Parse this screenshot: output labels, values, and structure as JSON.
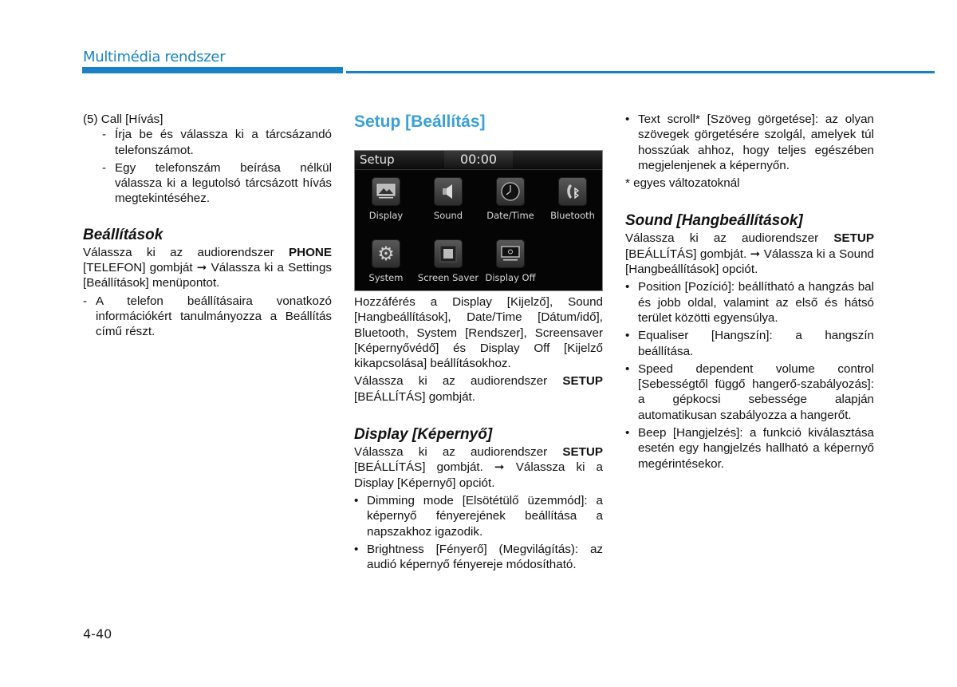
{
  "header": {
    "title": "Multimédia rendszer",
    "accent_color": "#1a82c4"
  },
  "col1": {
    "call_heading": "(5) Call [Hívás]",
    "call_items": [
      "Írja be és válassza ki a tárcsázandó telefonszámot.",
      "Egy telefonszám beírása nélkül válassza ki a legutolsó tárcsázott hívás megtekintéséhez."
    ],
    "settings_heading": "Beállítások",
    "settings_text_pre": "Válassza ki az audiorendszer ",
    "settings_text_bold": "PHONE",
    "settings_text_post": " [TELEFON] gombját ➞ Válassza ki a Settings [Beállítások] menüpontot.",
    "settings_note": "A telefon beállításaira vonatkozó információkért tanulmányozza a Beállítás című részt."
  },
  "col2": {
    "setup_heading": "Setup [Beállítás]",
    "screen": {
      "title": "Setup",
      "clock": "00:00",
      "tiles": [
        {
          "label": "Display",
          "icon": "display-icon"
        },
        {
          "label": "Sound",
          "icon": "speaker-icon"
        },
        {
          "label": "Date/Time",
          "icon": "clock-icon"
        },
        {
          "label": "Bluetooth",
          "icon": "bluetooth-phone-icon"
        },
        {
          "label": "System",
          "icon": "gear-icon"
        },
        {
          "label": "Screen Saver",
          "icon": "screensaver-icon"
        },
        {
          "label": "Display Off",
          "icon": "display-off-icon"
        }
      ]
    },
    "access_text": "Hozzáférés a Display [Kijelző], Sound [Hangbeállítások], Date/Time [Dátum/idő], Bluetooth, System [Rendszer], Screensaver [Képernyővédő] és Display Off [Kijelző kikapcsolása] beállításokhoz.",
    "select_pre": "Válassza ki az audiorendszer ",
    "select_bold": "SETUP",
    "select_post": " [BEÁLLÍTÁS] gombját.",
    "display_heading": "Display [Képernyő]",
    "display_pre": "Válassza ki az audiorendszer ",
    "display_bold": "SETUP",
    "display_post": " [BEÁLLÍTÁS] gombját. ➞ Válassza ki a Display [Képernyő] opciót.",
    "display_bullets": [
      "Dimming mode [Elsötétülő üzemmód]: a képernyő fényerejének beállítása a napszakhoz igazodik.",
      "Brightness [Fényerő] (Megvilágítás): az audió képernyő fényereje módosítható."
    ]
  },
  "col3": {
    "text_scroll": "Text scroll* [Szöveg görgetése]: az olyan szövegek görgetésére szolgál, amelyek túl hosszúak ahhoz, hogy teljes egészében megjelenjenek a képernyőn.",
    "footnote": "* egyes változatoknál",
    "sound_heading": "Sound [Hangbeállítások]",
    "sound_pre": "Válassza ki az audiorendszer ",
    "sound_bold": "SETUP",
    "sound_post": " [BEÁLLÍTÁS] gombját. ➞ Válassza ki a Sound [Hangbeállítások] opciót.",
    "sound_bullets": [
      "Position [Pozíció]: beállítható a hangzás bal és jobb oldal, valamint az első és hátsó terület közötti egyensúlya.",
      "Equaliser [Hangszín]: a hangszín beállítása.",
      "Speed dependent volume control [Sebességtől függő hangerő-szabályozás]: a gépkocsi sebessége alapján automatikusan szabályozza a hangerőt.",
      "Beep [Hangjelzés]: a funkció kiválasztása esetén egy hangjelzés hallható a képernyő megérintésekor."
    ]
  },
  "footer": {
    "page_number": "4-40"
  }
}
